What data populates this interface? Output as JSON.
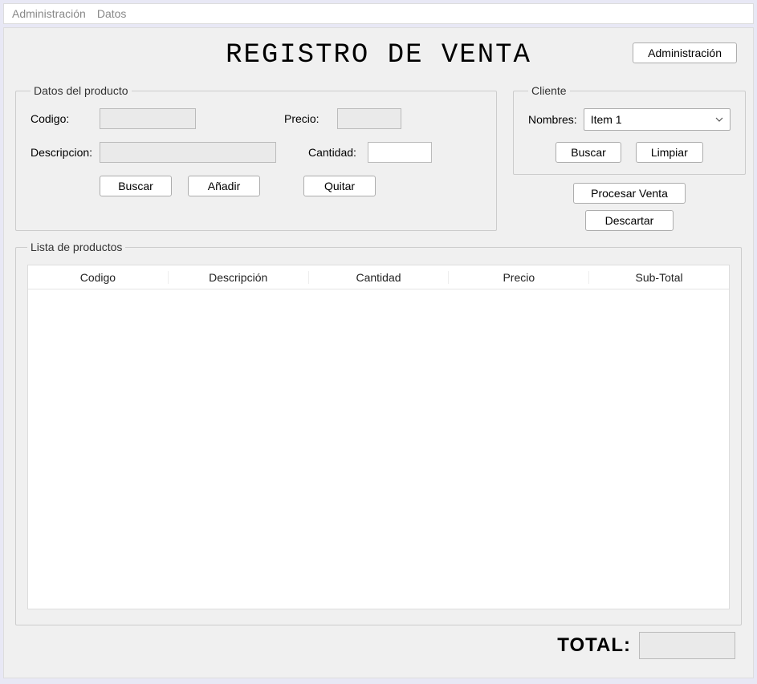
{
  "menubar": {
    "administracion": "Administración",
    "datos": "Datos"
  },
  "header": {
    "title": "REGISTRO DE VENTA",
    "admin_button": "Administración"
  },
  "producto": {
    "legend": "Datos del producto",
    "codigo_label": "Codigo:",
    "codigo_value": "",
    "precio_label": "Precio:",
    "precio_value": "",
    "descripcion_label": "Descripcion:",
    "descripcion_value": "",
    "cantidad_label": "Cantidad:",
    "cantidad_value": "",
    "buscar": "Buscar",
    "anadir": "Añadir",
    "quitar": "Quitar"
  },
  "cliente": {
    "legend": "Cliente",
    "nombres_label": "Nombres:",
    "nombres_selected": "Item 1",
    "buscar": "Buscar",
    "limpiar": "Limpiar"
  },
  "acciones": {
    "procesar": "Procesar Venta",
    "descartar": "Descartar"
  },
  "lista": {
    "legend": "Lista de productos",
    "columns": {
      "codigo": "Codigo",
      "descripcion": "Descripción",
      "cantidad": "Cantidad",
      "precio": "Precio",
      "subtotal": "Sub-Total"
    },
    "rows": []
  },
  "total": {
    "label": "TOTAL:",
    "value": ""
  }
}
